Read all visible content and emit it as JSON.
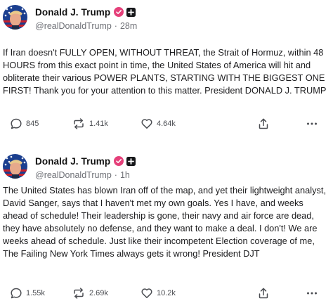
{
  "posts": [
    {
      "display_name": "Donald J. Trump",
      "handle": "@realDonaldTrump",
      "separator": "·",
      "time": "28m",
      "text": "If Iran doesn't FULLY OPEN, WITHOUT THREAT, the Strait of Hormuz, within 48 HOURS from this exact point in time, the United States of America will hit and obliterate their various POWER PLANTS, STARTING WITH THE BIGGEST ONE FIRST! Thank you for your attention to this matter. President DONALD J. TRUMP",
      "replies": "845",
      "retruths": "1.41k",
      "likes": "4.64k"
    },
    {
      "display_name": "Donald J. Trump",
      "handle": "@realDonaldTrump",
      "separator": "·",
      "time": "1h",
      "text": "The United States has blown Iran off of the map, and yet their lightweight analyst, David Sanger, says that I haven't met my own goals. Yes I have, and weeks ahead of schedule! Their leadership is gone, their navy and air force are dead, they have absolutely no defense, and they want to make a deal. I don't! We are weeks ahead of schedule. Just like their incompetent Election coverage of me, The Failing New York Times always gets it wrong! President DJT",
      "replies": "1.55k",
      "retruths": "2.69k",
      "likes": "10.2k"
    }
  ],
  "colors": {
    "verified_badge": "#e5407a",
    "icon_gray": "#4b4d52",
    "handle_gray": "#6f7177"
  },
  "icons": {
    "verified": "verified-badge-icon",
    "plus": "plus-box-icon",
    "reply": "reply-bubble-icon",
    "retruth": "retruth-arrows-icon",
    "like": "heart-icon",
    "share": "share-icon",
    "more": "more-dots-icon"
  }
}
